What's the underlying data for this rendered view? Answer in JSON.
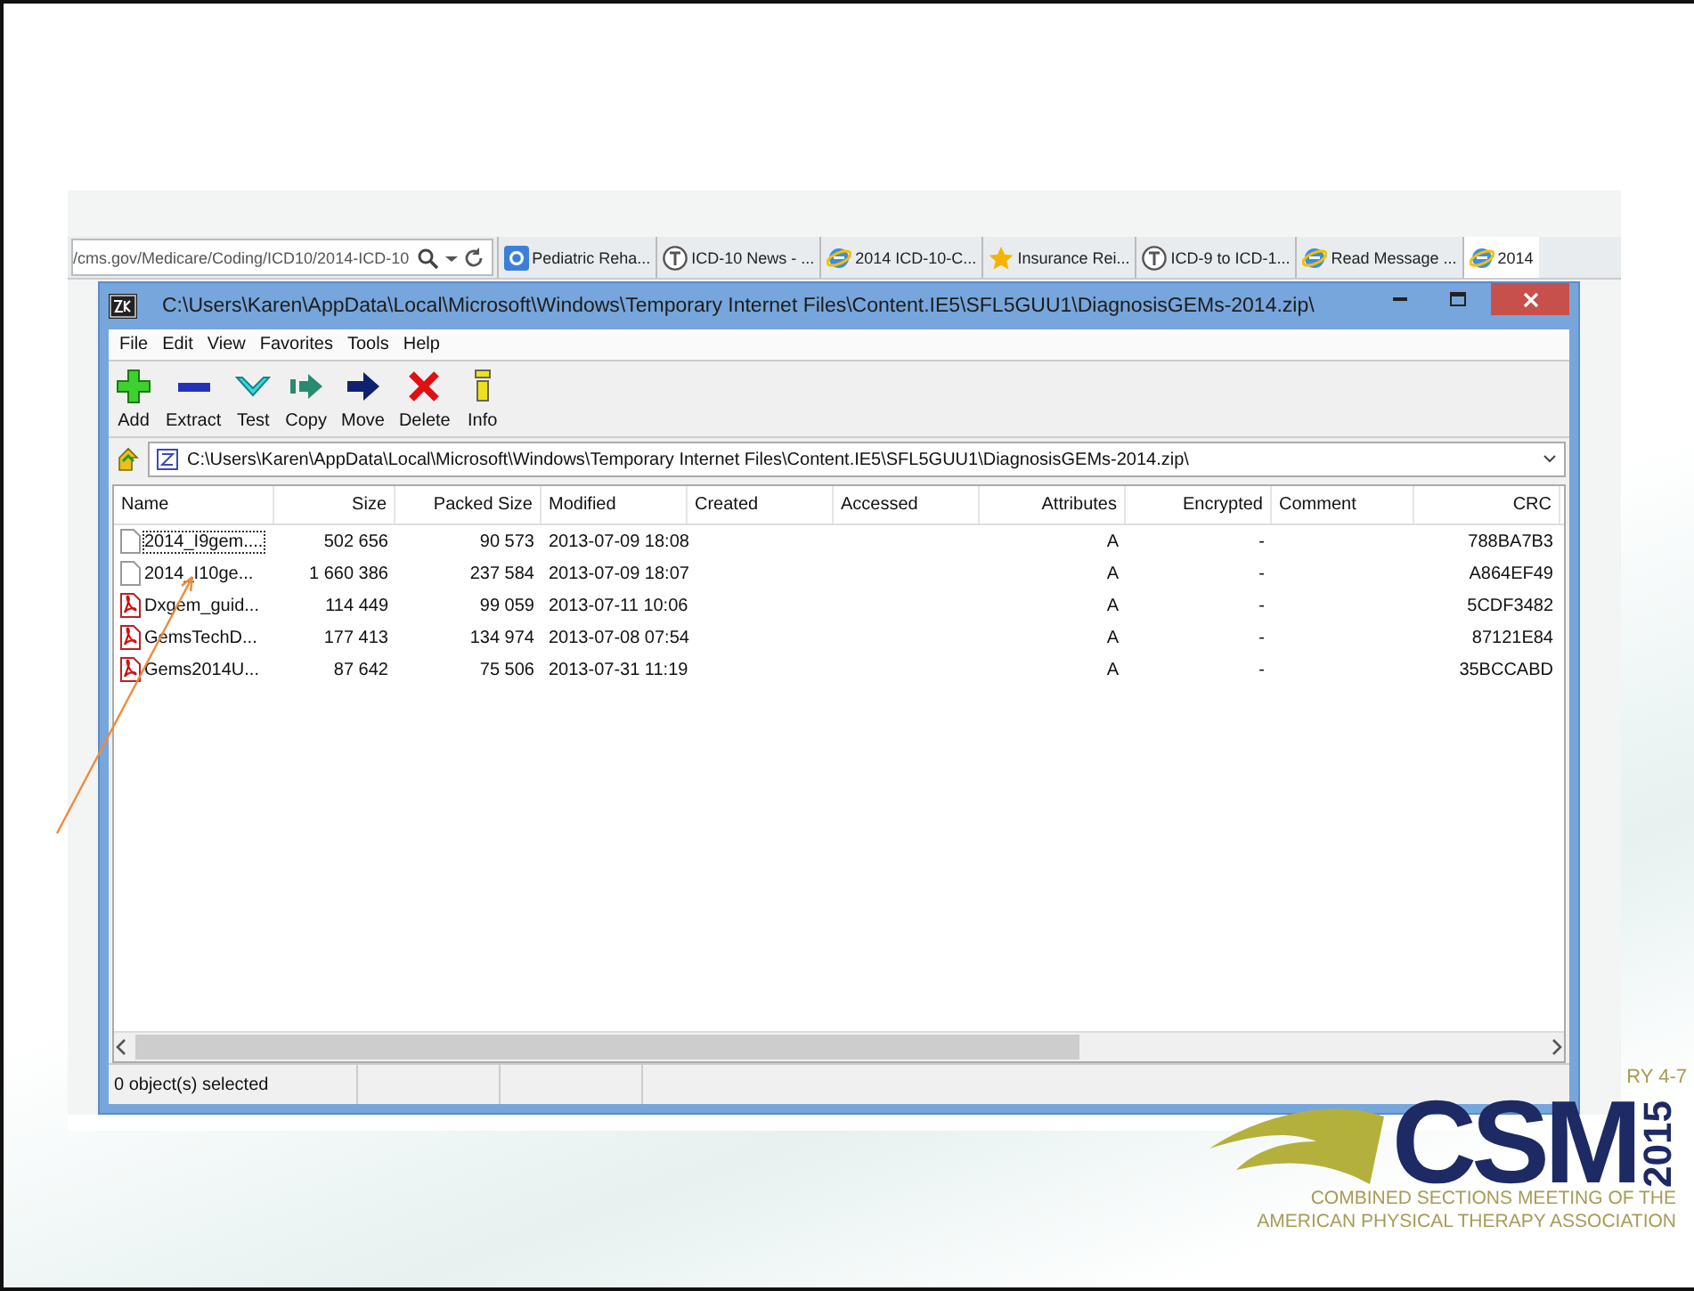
{
  "browser": {
    "address": "/cms.gov/Medicare/Coding/ICD10/2014-ICD-10",
    "tabs": [
      {
        "label": "Pediatric Reha...",
        "selected": false
      },
      {
        "label": "ICD-10 News - ...",
        "selected": false
      },
      {
        "label": "2014 ICD-10-C...",
        "selected": false
      },
      {
        "label": "Insurance Rei...",
        "selected": false
      },
      {
        "label": "ICD-9 to ICD-1...",
        "selected": false
      },
      {
        "label": "Read Message ...",
        "selected": false
      },
      {
        "label": "2014",
        "selected": true
      }
    ]
  },
  "window": {
    "title": "C:\\Users\\Karen\\AppData\\Local\\Microsoft\\Windows\\Temporary Internet Files\\Content.IE5\\SFL5GUU1\\DiagnosisGEMs-2014.zip\\",
    "menu": [
      "File",
      "Edit",
      "View",
      "Favorites",
      "Tools",
      "Help"
    ],
    "toolbar": [
      "Add",
      "Extract",
      "Test",
      "Copy",
      "Move",
      "Delete",
      "Info"
    ],
    "path": "C:\\Users\\Karen\\AppData\\Local\\Microsoft\\Windows\\Temporary Internet Files\\Content.IE5\\SFL5GUU1\\DiagnosisGEMs-2014.zip\\",
    "columns": [
      "Name",
      "Size",
      "Packed Size",
      "Modified",
      "Created",
      "Accessed",
      "Attributes",
      "Encrypted",
      "Comment",
      "CRC"
    ],
    "rows": [
      {
        "kind": "text",
        "focused": true,
        "cells": [
          "2014_I9gem....",
          "502 656",
          "90 573",
          "2013-07-09 18:08",
          "",
          "",
          "A",
          "-",
          "",
          "788BA7B3"
        ]
      },
      {
        "kind": "text",
        "focused": false,
        "cells": [
          "2014_I10ge...",
          "1 660 386",
          "237 584",
          "2013-07-09 18:07",
          "",
          "",
          "A",
          "-",
          "",
          "A864EF49"
        ]
      },
      {
        "kind": "pdf",
        "focused": false,
        "cells": [
          "Dxgem_guid...",
          "114 449",
          "99 059",
          "2013-07-11 10:06",
          "",
          "",
          "A",
          "-",
          "",
          "5CDF3482"
        ]
      },
      {
        "kind": "pdf",
        "focused": false,
        "cells": [
          "GemsTechD...",
          "177 413",
          "134 974",
          "2013-07-08 07:54",
          "",
          "",
          "A",
          "-",
          "",
          "87121E84"
        ]
      },
      {
        "kind": "pdf",
        "focused": false,
        "cells": [
          "Gems2014U...",
          "87 642",
          "75 506",
          "2013-07-31 11:19",
          "",
          "",
          "A",
          "-",
          "",
          "35BCCABD"
        ]
      }
    ],
    "status": "0 object(s) selected"
  },
  "slide": {
    "date_fragment": "RY 4-7",
    "logo": {
      "mark": "CSM",
      "year": "2015",
      "lines": [
        "COMBINED SECTIONS MEETING OF THE",
        "AMERICAN PHYSICAL THERAPY ASSOCIATION"
      ]
    }
  }
}
